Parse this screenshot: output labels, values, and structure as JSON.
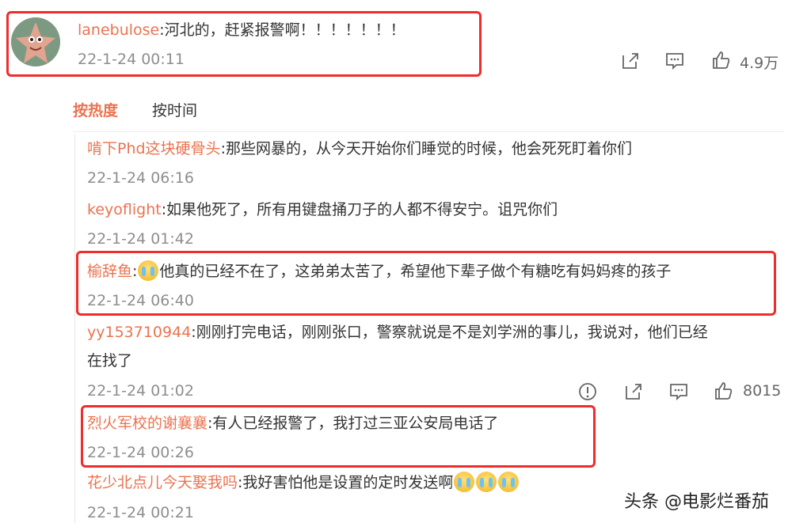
{
  "main_comment": {
    "username": "lanebulose",
    "text": ":河北的，赶紧报警啊！！！！！！！",
    "timestamp": "22-1-24 00:11",
    "like_count": "4.9万"
  },
  "sort_tabs": {
    "hot": "按热度",
    "time": "按时间"
  },
  "replies": [
    {
      "username": "啃下Phd这块硬骨头",
      "text": ":那些网暴的，从今天开始你们睡觉的时候，他会死死盯着你们",
      "timestamp": "22-1-24 06:16"
    },
    {
      "username": "keyoflight",
      "text": ":如果他死了，所有用键盘捅刀子的人都不得安宁。诅咒你们",
      "timestamp": "22-1-24 01:42"
    },
    {
      "username": "榆辞鱼",
      "text_prefix": ":",
      "text": "他真的已经不在了，这弟弟太苦了，希望他下辈子做个有糖吃有妈妈疼的孩子",
      "timestamp": "22-1-24 06:40"
    },
    {
      "username": "yy153710944",
      "text": ":刚刚打完电话，刚刚张口，警察就说是不是刘学洲的事儿，我说对，他们已经",
      "text_line2": "在找了",
      "timestamp": "22-1-24 01:02",
      "like_count": "8015"
    },
    {
      "username": "烈火军校的谢襄襄",
      "text": ":有人已经报警了，我打过三亚公安局电话了",
      "timestamp": "22-1-24 00:26"
    },
    {
      "username": "花少北点儿今天娶我吗",
      "text": ":我好害怕他是设置的定时发送啊",
      "timestamp": "22-1-24 00:21"
    }
  ],
  "icons": {
    "share": "share-icon",
    "comment": "comment-icon",
    "like": "thumbs-up-icon",
    "report": "report-icon",
    "crying_emoji": "crying-emoji-icon"
  },
  "colors": {
    "username": "#eb7350",
    "highlight_box": "#f02c2c",
    "meta": "#8e8e8e"
  },
  "watermark": "头条 @电影烂番茄"
}
